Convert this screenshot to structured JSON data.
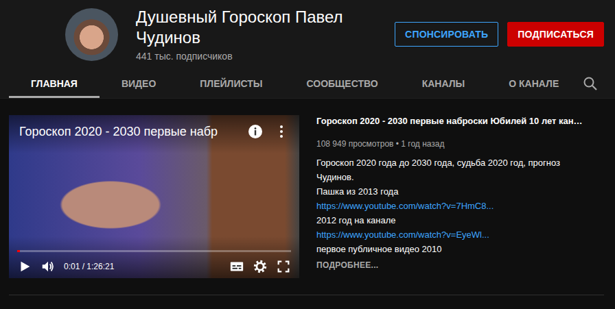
{
  "channel": {
    "name": "Душевный Гороскоп Павел Чудинов",
    "subscribers": "441 тыс. подписчиков"
  },
  "header_buttons": [
    {
      "label": "СПОНСИРОВАТЬ",
      "kind": "outline"
    },
    {
      "label": "ПОДПИСАТЬСЯ",
      "kind": "filled"
    }
  ],
  "tabs": [
    {
      "label": "ГЛАВНАЯ",
      "selected": true
    },
    {
      "label": "ВИДЕО",
      "selected": false
    },
    {
      "label": "ПЛЕЙЛИСТЫ",
      "selected": false
    },
    {
      "label": "СООБЩЕСТВО",
      "selected": false
    },
    {
      "label": "КАНАЛЫ",
      "selected": false
    },
    {
      "label": "О КАНАЛЕ",
      "selected": false
    }
  ],
  "player": {
    "title": "Гороскоп 2020 - 2030 первые набр",
    "time": "0:01 / 1:26:21",
    "level": 0.01,
    "playing": false
  },
  "video": {
    "title": "Гороскоп 2020 - 2030 первые наброски Юбилей 10 лет кан…",
    "meta": "108 949 просмотров • 1 год назад",
    "description": [
      {
        "text": "Гороскоп 2020 года до 2030 года, судьба 2020 год, прогноз",
        "kind": "text"
      },
      {
        "text": "Чудинов.",
        "kind": "text"
      },
      {
        "text": "Пашка из 2013 года",
        "kind": "text"
      },
      {
        "text": "https://www.youtube.com/watch?v=7HmC8...",
        "kind": "link"
      },
      {
        "text": "2012 год на канале",
        "kind": "text"
      },
      {
        "text": "https://www.youtube.com/watch?v=EyeWl...",
        "kind": "link"
      },
      {
        "text": "первое публичное видео 2010",
        "kind": "text"
      }
    ],
    "more": "ПОДРОБНЕЕ..."
  }
}
